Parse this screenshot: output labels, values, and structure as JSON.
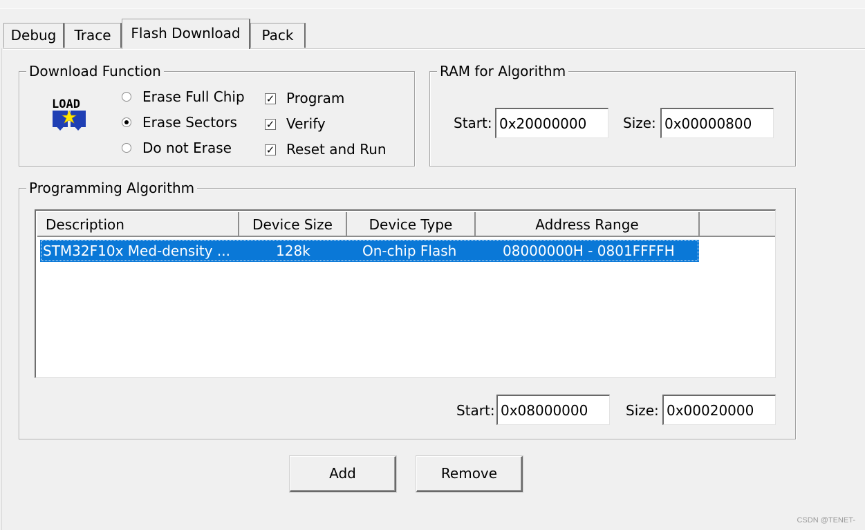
{
  "tabs": [
    {
      "label": "Debug",
      "active": false
    },
    {
      "label": "Trace",
      "active": false
    },
    {
      "label": "Flash Download",
      "active": true
    },
    {
      "label": "Pack",
      "active": false
    }
  ],
  "download_function": {
    "title": "Download Function",
    "icon": "load-icon",
    "icon_text": "LOAD",
    "radios": [
      {
        "label": "Erase Full Chip",
        "selected": false
      },
      {
        "label": "Erase Sectors",
        "selected": true
      },
      {
        "label": "Do not Erase",
        "selected": false
      }
    ],
    "checks": [
      {
        "label": "Program",
        "checked": true
      },
      {
        "label": "Verify",
        "checked": true
      },
      {
        "label": "Reset and Run",
        "checked": true
      }
    ],
    "check_mark": "✓"
  },
  "ram": {
    "title": "RAM for Algorithm",
    "start_label": "Start:",
    "start_value": "0x20000000",
    "size_label": "Size:",
    "size_value": "0x00000800"
  },
  "programming": {
    "title": "Programming Algorithm",
    "columns": [
      "Description",
      "Device Size",
      "Device Type",
      "Address Range"
    ],
    "rows": [
      {
        "description": "STM32F10x Med-density ...",
        "size": "128k",
        "type": "On-chip Flash",
        "range": "08000000H - 0801FFFFH",
        "selected": true
      }
    ],
    "start_label": "Start:",
    "start_value": "0x08000000",
    "size_label": "Size:",
    "size_value": "0x00020000"
  },
  "buttons": {
    "add": "Add",
    "remove": "Remove"
  },
  "colors": {
    "selection": "#0a78d7",
    "background": "#f0f0f0"
  },
  "watermark": "CSDN @TENET-"
}
